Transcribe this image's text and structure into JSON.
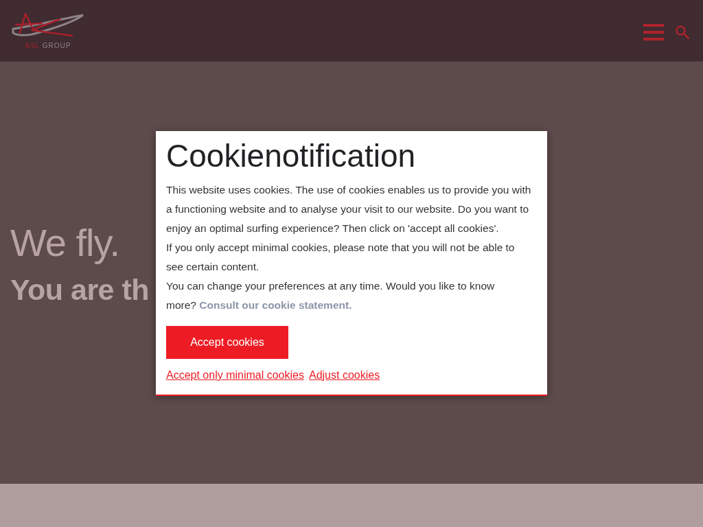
{
  "header": {
    "logo": {
      "accent_text": "ASL",
      "text": "GROUP"
    }
  },
  "hero": {
    "heading": "We fly.",
    "subheading": "You are th"
  },
  "cookie_dialog": {
    "title": "Cookienotification",
    "paragraphs": [
      {
        "text": "This website uses cookies. The use of cookies enables us to provide you with a functioning website and to analyse your visit to our website. Do you want to enjoy an optimal surfing experience? Then click on 'accept all cookies'."
      },
      {
        "text": "If you only accept minimal cookies, please note that you will not be able to see certain content."
      },
      {
        "text": "You can change your preferences at any time. Would you like to know more?",
        "link": "Consult our cookie statement."
      }
    ],
    "primary_button": "Accept cookies",
    "links": [
      "Accept only minimal cookies",
      "Adjust cookies"
    ]
  }
}
